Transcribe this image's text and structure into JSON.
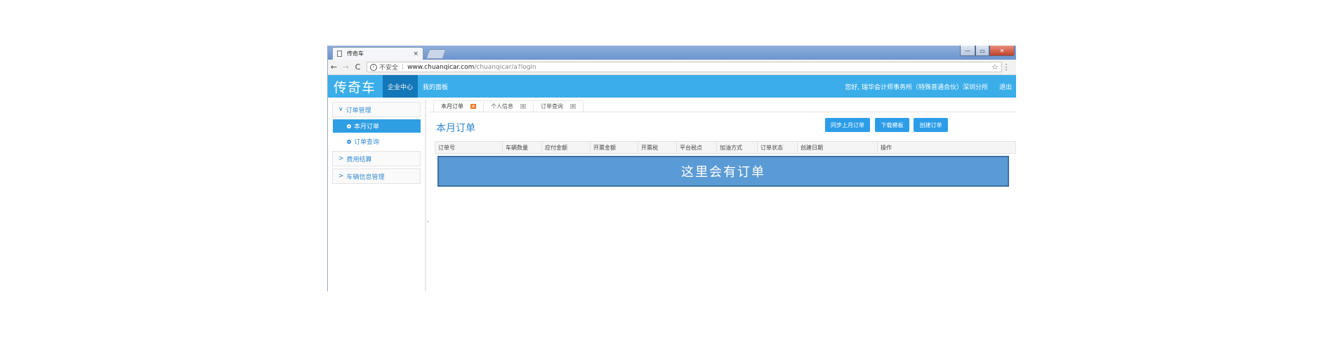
{
  "browser": {
    "tab_title": "传奇车",
    "tab_close": "×",
    "security_label": "不安全",
    "separator": "|",
    "url_host": "www.chuanqicar.com",
    "url_path": "/chuanqicar/a?login",
    "back": "←",
    "forward": "→",
    "reload": "C",
    "info": "i",
    "star": "☆",
    "menu": "⋮",
    "window_buttons": {
      "min": "—",
      "max": "▭",
      "close": "✕"
    }
  },
  "header": {
    "logo": "传奇车",
    "nav": [
      "企业中心",
      "我的面板"
    ],
    "greeting": "您好, 瑞华会计师事务所（特殊普通合伙）深圳分所",
    "logout": "退出"
  },
  "sidebar": {
    "groups": [
      {
        "label": "订单管理",
        "expanded": true,
        "items": [
          "本月订单",
          "订单查询"
        ]
      },
      {
        "label": "费用结算",
        "expanded": false
      },
      {
        "label": "车辆信息管理",
        "expanded": false
      }
    ],
    "collapse_handle": "‹"
  },
  "content": {
    "tabs": [
      "本月订单",
      "个人信息",
      "订单查询"
    ],
    "tab_close": "x",
    "page_title": "本月订单",
    "buttons": [
      "同步上月订单",
      "下载模板",
      "创建订单"
    ],
    "columns": [
      "订单号",
      "车辆数量",
      "应付金额",
      "开票金额",
      "开票税",
      "平台税点",
      "加油方式",
      "订单状态",
      "创建日期",
      "操作"
    ],
    "placeholder": "这里会有订单"
  },
  "colors": {
    "header_bg": "#3baeea",
    "active_nav": "#1477b8",
    "button": "#2b9de8",
    "placeholder_box": "#5b9bd5"
  }
}
